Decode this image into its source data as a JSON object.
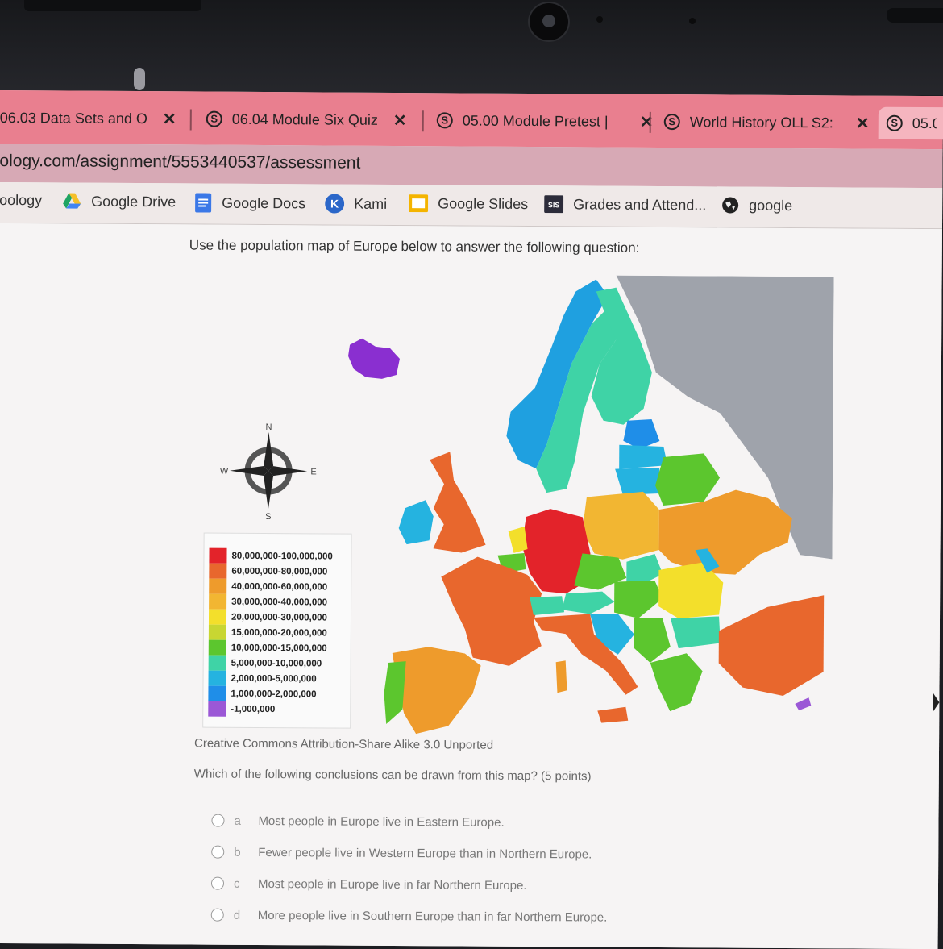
{
  "tabs": [
    {
      "label": "06.03 Data Sets and O",
      "close": "✕"
    },
    {
      "label": "06.04 Module Six Quiz",
      "close": "✕"
    },
    {
      "label": "05.00 Module Pretest |",
      "close": "✕"
    },
    {
      "label": "World History OLL S2:",
      "close": "✕"
    },
    {
      "label": "05.0"
    }
  ],
  "url": "ology.com/assignment/5553440537/assessment",
  "bookmarks": [
    {
      "label": "oology"
    },
    {
      "label": "Google Drive",
      "icon": "google-drive-icon"
    },
    {
      "label": "Google Docs",
      "icon": "google-docs-icon"
    },
    {
      "label": "Kami",
      "icon": "kami-icon"
    },
    {
      "label": "Google Slides",
      "icon": "google-slides-icon"
    },
    {
      "label": "Grades and Attend...",
      "icon": "sis-icon"
    },
    {
      "label": "google",
      "icon": "globe-icon"
    }
  ],
  "prompt": "Use the population map of Europe below to answer the following question:",
  "compass": {
    "n": "N",
    "s": "S",
    "e": "E",
    "w": "W"
  },
  "legend": [
    {
      "label": "80,000,000-100,000,000",
      "color": "#e3232a"
    },
    {
      "label": "60,000,000-80,000,000",
      "color": "#e8672d"
    },
    {
      "label": "40,000,000-60,000,000",
      "color": "#ee9b2c"
    },
    {
      "label": "30,000,000-40,000,000",
      "color": "#f2b632"
    },
    {
      "label": "20,000,000-30,000,000",
      "color": "#f3df2b"
    },
    {
      "label": "15,000,000-20,000,000",
      "color": "#c8d632"
    },
    {
      "label": "10,000,000-15,000,000",
      "color": "#5cc62e"
    },
    {
      "label": "5,000,000-10,000,000",
      "color": "#3fd3a6"
    },
    {
      "label": "2,000,000-5,000,000",
      "color": "#25b3e0"
    },
    {
      "label": "1,000,000-2,000,000",
      "color": "#1f8ee8"
    },
    {
      "label": "-1,000,000",
      "color": "#9b58d6"
    }
  ],
  "credit": "Creative Commons Attribution-Share Alike 3.0 Unported",
  "question": "Which of the following conclusions can be drawn from this map? (5 points)",
  "options": [
    {
      "letter": "a",
      "text": "Most people in Europe live in Eastern Europe."
    },
    {
      "letter": "b",
      "text": "Fewer people live in Western Europe than in Northern Europe."
    },
    {
      "letter": "c",
      "text": "Most people in Europe live in far Northern Europe."
    },
    {
      "letter": "d",
      "text": "More people live in Southern Europe than in far Northern Europe."
    }
  ]
}
